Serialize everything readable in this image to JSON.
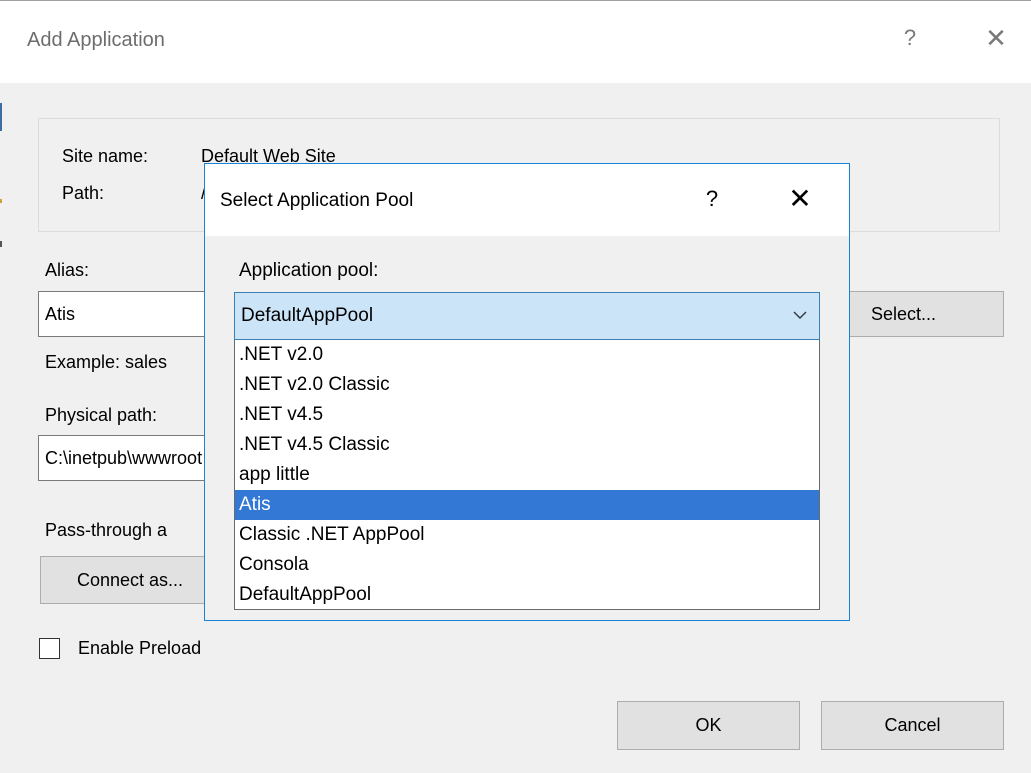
{
  "outer_dialog": {
    "title": "Add Application",
    "help_glyph": "?",
    "close_glyph": "✕",
    "site_name_label": "Site name:",
    "site_name_value": "Default Web Site",
    "path_label": "Path:",
    "path_value": "/",
    "alias_label": "Alias:",
    "alias_value": "Atis",
    "example_text": "Example: sales",
    "select_button": "Select...",
    "physical_path_label": "Physical path:",
    "physical_path_value": "C:\\inetpub\\wwwroot",
    "pass_through_label": "Pass-through a",
    "connect_as_button": "Connect as...",
    "enable_preload_label": "Enable Preload",
    "enable_preload_checked": false,
    "ok_button": "OK",
    "cancel_button": "Cancel"
  },
  "inner_dialog": {
    "title": "Select Application Pool",
    "help_glyph": "?",
    "close_glyph": "✕",
    "pool_label": "Application pool:",
    "selected_pool": "DefaultAppPool",
    "options": [
      ".NET v2.0",
      ".NET v2.0 Classic",
      ".NET v4.5",
      ".NET v4.5 Classic",
      "app little",
      "Atis",
      "Classic .NET AppPool",
      "Consola",
      "DefaultAppPool"
    ],
    "highlighted_option": "Atis"
  },
  "colors": {
    "window_bg": "#f0f0f0",
    "accent_border": "#1883d7",
    "highlight": "#3478d6",
    "combo_bg": "#cce4f7"
  }
}
